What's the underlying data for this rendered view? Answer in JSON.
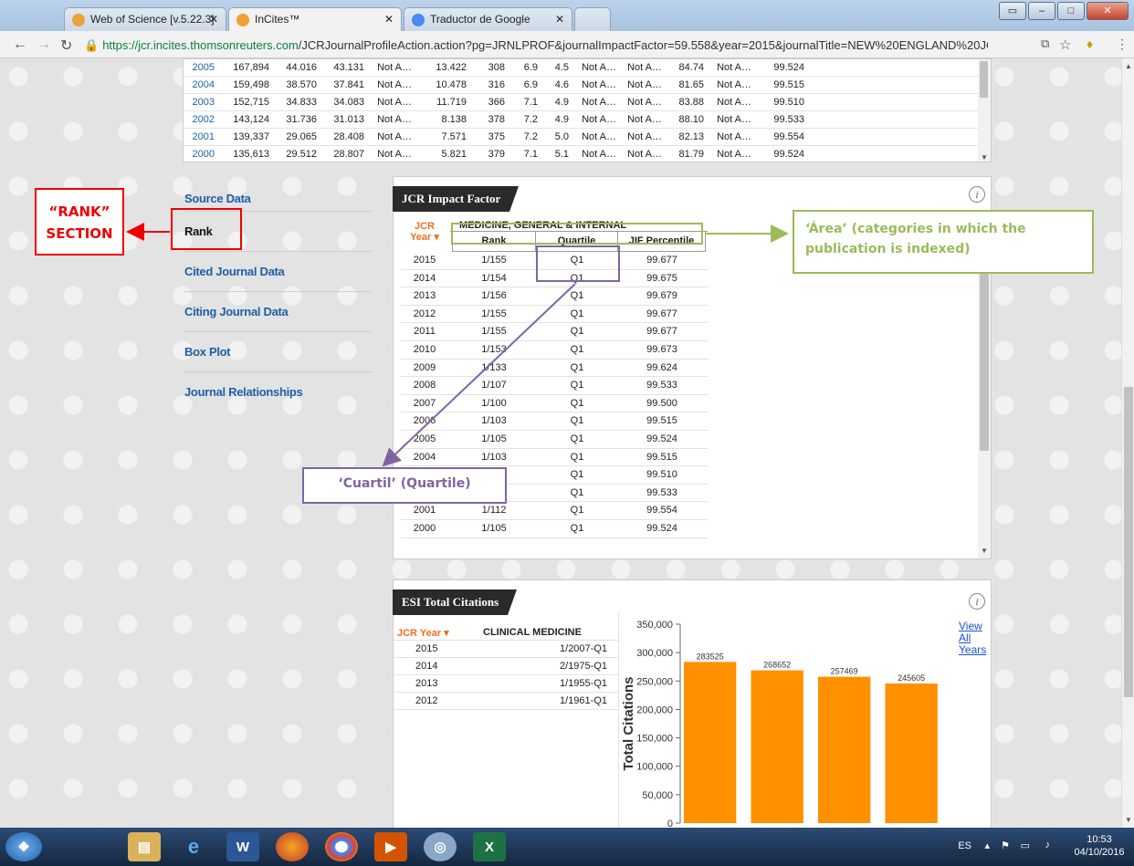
{
  "browser": {
    "tabs": [
      {
        "label": "Web of Science [v.5.22.3]",
        "active": false
      },
      {
        "label": "InCites™",
        "active": true
      },
      {
        "label": "Traductor de Google",
        "active": false
      }
    ],
    "url_host": "https://jcr.incites.thomsonreuters.com",
    "url_path": "/JCRJournalProfileAction.action?pg=JRNLPROF&journalImpactFactor=59.558&year=2015&journalTitle=NEW%20ENGLAND%20JOU"
  },
  "top_table": {
    "rows": [
      [
        "2005",
        "167,894",
        "44.016",
        "43.131",
        "Not A…",
        "13.422",
        "308",
        "6.9",
        "4.5",
        "Not A…",
        "Not A…",
        "84.74",
        "Not A…",
        "99.524"
      ],
      [
        "2004",
        "159,498",
        "38.570",
        "37.841",
        "Not A…",
        "10.478",
        "316",
        "6.9",
        "4.6",
        "Not A…",
        "Not A…",
        "81.65",
        "Not A…",
        "99.515"
      ],
      [
        "2003",
        "152,715",
        "34.833",
        "34.083",
        "Not A…",
        "11.719",
        "366",
        "7.1",
        "4.9",
        "Not A…",
        "Not A…",
        "83.88",
        "Not A…",
        "99.510"
      ],
      [
        "2002",
        "143,124",
        "31.736",
        "31.013",
        "Not A…",
        "8.138",
        "378",
        "7.2",
        "4.9",
        "Not A…",
        "Not A…",
        "88.10",
        "Not A…",
        "99.533"
      ],
      [
        "2001",
        "139,337",
        "29.065",
        "28.408",
        "Not A…",
        "7.571",
        "375",
        "7.2",
        "5.0",
        "Not A…",
        "Not A…",
        "82.13",
        "Not A…",
        "99.554"
      ],
      [
        "2000",
        "135,613",
        "29.512",
        "28.807",
        "Not A…",
        "5.821",
        "379",
        "7.1",
        "5.1",
        "Not A…",
        "Not A…",
        "81.79",
        "Not A…",
        "99.524"
      ]
    ]
  },
  "leftnav": [
    {
      "label": "Source Data",
      "active": false
    },
    {
      "label": "Rank",
      "active": true
    },
    {
      "label": "Cited Journal Data",
      "active": false
    },
    {
      "label": "Citing Journal Data",
      "active": false
    },
    {
      "label": "Box Plot",
      "active": false
    },
    {
      "label": "Journal Relationships",
      "active": false
    }
  ],
  "jcr_panel": {
    "title": "JCR Impact Factor",
    "info": "i",
    "category": "MEDICINE, GENERAL & INTERNAL",
    "year_header": "JCR Year ▾",
    "columns": [
      "Rank",
      "Quartile",
      "JIF Percentile"
    ],
    "rows": [
      [
        "2015",
        "1/155",
        "Q1",
        "99.677"
      ],
      [
        "2014",
        "1/154",
        "Q1",
        "99.675"
      ],
      [
        "2013",
        "1/156",
        "Q1",
        "99.679"
      ],
      [
        "2012",
        "1/155",
        "Q1",
        "99.677"
      ],
      [
        "2011",
        "1/155",
        "Q1",
        "99.677"
      ],
      [
        "2010",
        "1/153",
        "Q1",
        "99.673"
      ],
      [
        "2009",
        "1/133",
        "Q1",
        "99.624"
      ],
      [
        "2008",
        "1/107",
        "Q1",
        "99.533"
      ],
      [
        "2007",
        "1/100",
        "Q1",
        "99.500"
      ],
      [
        "2006",
        "1/103",
        "Q1",
        "99.515"
      ],
      [
        "2005",
        "1/105",
        "Q1",
        "99.524"
      ],
      [
        "2004",
        "1/103",
        "Q1",
        "99.515"
      ],
      [
        "2003",
        "1/102",
        "Q1",
        "99.510"
      ],
      [
        "2002",
        "1/107",
        "Q1",
        "99.533"
      ],
      [
        "2001",
        "1/112",
        "Q1",
        "99.554"
      ],
      [
        "2000",
        "1/105",
        "Q1",
        "99.524"
      ]
    ]
  },
  "esi_panel": {
    "title": "ESI Total Citations",
    "info": "i",
    "year_header": "JCR Year ▾",
    "category": "CLINICAL MEDICINE",
    "rows": [
      [
        "2015",
        "1/2007-Q1"
      ],
      [
        "2014",
        "2/1975-Q1"
      ],
      [
        "2013",
        "1/1955-Q1"
      ],
      [
        "2012",
        "1/1961-Q1"
      ]
    ],
    "view_all": [
      "View",
      "All",
      "Years"
    ]
  },
  "chart_data": {
    "type": "bar",
    "categories": [
      "2015",
      "2014",
      "2013",
      "2012"
    ],
    "values": [
      283525,
      268652,
      257469,
      245605
    ],
    "ylabel": "Total Citations",
    "ylim": [
      0,
      350000
    ],
    "yticks": [
      "0",
      "50,000",
      "100,000",
      "150,000",
      "200,000",
      "250,000",
      "300,000",
      "350,000"
    ],
    "bar_color": "#ff9000"
  },
  "annotations": {
    "rank_section": [
      "“RANK”",
      "SECTION"
    ],
    "area": "‘Área’ (categories in which the publication is indexed)",
    "cuartil": "‘Cuartil’ (Quartile)"
  },
  "taskbar": {
    "lang": "ES",
    "time": "10:53",
    "date": "04/10/2016"
  }
}
